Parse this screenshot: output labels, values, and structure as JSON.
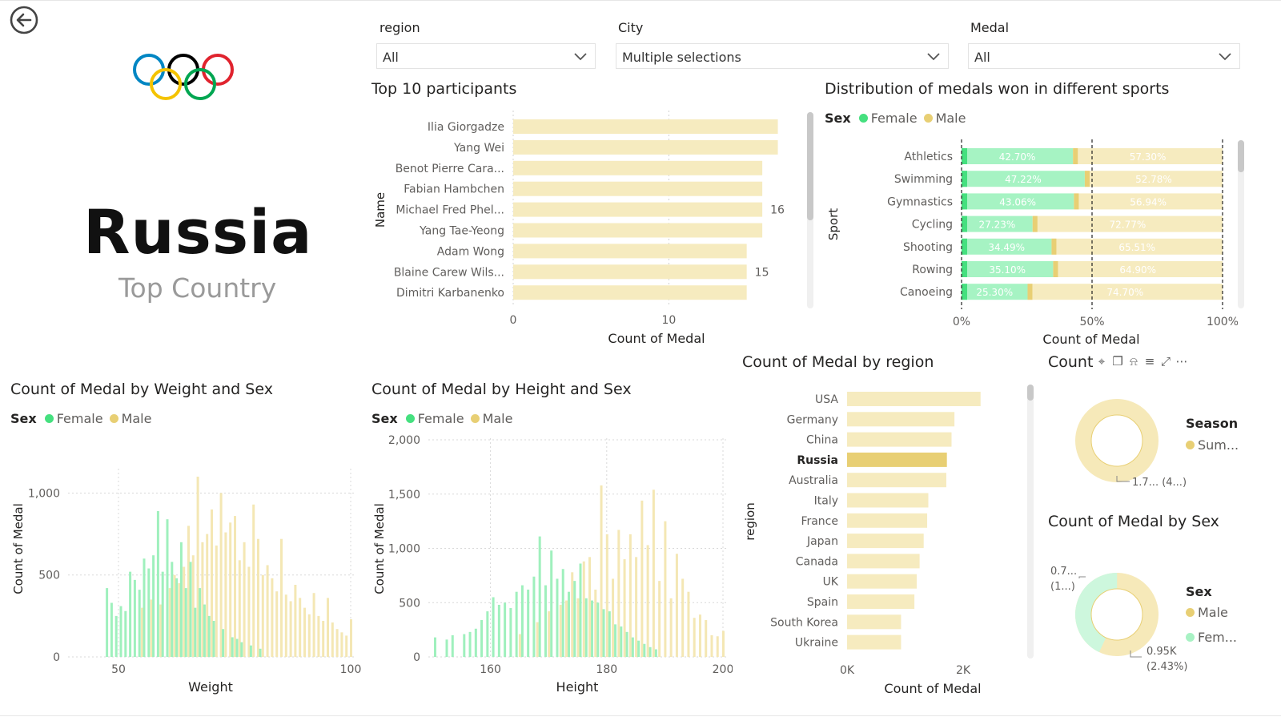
{
  "filters": [
    {
      "label": "region",
      "value": "All"
    },
    {
      "label": "City",
      "value": "Multiple selections"
    },
    {
      "label": "Medal",
      "value": "All"
    }
  ],
  "hero": {
    "country": "Russia",
    "subtitle": "Top Country"
  },
  "top_participants": {
    "title": "Top 10 participants",
    "xlabel": "Count of Medal",
    "ylabel": "Name",
    "ticks": [
      "0",
      "10"
    ]
  },
  "sports_dist": {
    "title": "Distribution of medals won in different sports",
    "legend_title": "Sex",
    "legend": [
      "Female",
      "Male"
    ],
    "ylabel": "Sport",
    "xlabel": "Count of Medal",
    "ticks": [
      "0%",
      "50%",
      "100%"
    ]
  },
  "weight_chart": {
    "title": "Count of Medal by Weight and Sex",
    "legend_title": "Sex",
    "legend": [
      "Female",
      "Male"
    ],
    "xlabel": "Weight",
    "ylabel": "Count of Medal",
    "xticks": [
      "50",
      "100"
    ],
    "yticks": [
      "0",
      "500",
      "1,000"
    ]
  },
  "height_chart": {
    "title": "Count of Medal by Height and Sex",
    "legend_title": "Sex",
    "legend": [
      "Female",
      "Male"
    ],
    "xlabel": "Height",
    "ylabel": "Count of Medal",
    "xticks": [
      "160",
      "180",
      "200"
    ],
    "yticks": [
      "0",
      "500",
      "1,000",
      "1,500",
      "2,000"
    ]
  },
  "region_chart": {
    "title": "Count of Medal by region",
    "xlabel": "Count of Medal",
    "ylabel": "region",
    "ticks": [
      "0K",
      "2K"
    ]
  },
  "season_donut": {
    "title": "Count",
    "legend_title": "Season",
    "legend": [
      "Sum..."
    ],
    "label": "1.7... (4...)"
  },
  "sex_donut": {
    "title": "Count of Medal by Sex",
    "legend_title": "Sex",
    "legend": [
      "Male",
      "Fem..."
    ],
    "label_female_1": "0.7...",
    "label_female_2": "(1...)",
    "label_male_1": "0.95K",
    "label_male_2": "(2.43%)"
  },
  "colors": {
    "female": "#45e07f",
    "male": "#e8cf74",
    "bar": "#f6ebbf",
    "highlight": "#e8cf74"
  },
  "chart_data": [
    {
      "type": "bar",
      "title": "Top 10 participants",
      "categories": [
        "Ilia Giorgadze",
        "Yang Wei",
        "Benot Pierre Cara...",
        "Fabian Hambchen",
        "Michael Fred Phel...",
        "Yang Tae-Yeong",
        "Adam Wong",
        "Blaine Carew Wils...",
        "Dimitri Karbanenko"
      ],
      "values": [
        17,
        17,
        16,
        16,
        16,
        16,
        15,
        15,
        15
      ],
      "data_labels": {
        "Michael Fred Phel...": "16",
        "Blaine Carew Wils...": "15"
      },
      "xlabel": "Count of Medal",
      "ylabel": "Name",
      "xlim": [
        0,
        18
      ]
    },
    {
      "type": "bar",
      "stacked": "100%",
      "title": "Distribution of medals won in different sports",
      "categories": [
        "Athletics",
        "Swimming",
        "Gymnastics",
        "Cycling",
        "Shooting",
        "Rowing",
        "Canoeing"
      ],
      "series": [
        {
          "name": "Female",
          "values": [
            42.7,
            47.22,
            43.06,
            27.23,
            34.49,
            35.1,
            25.3
          ],
          "labels": [
            "42.70%",
            "47.22%",
            "43.06%",
            "27.23%",
            "34.49%",
            "35.10%",
            "25.30%"
          ]
        },
        {
          "name": "Male",
          "values": [
            57.3,
            52.78,
            56.94,
            72.77,
            65.51,
            64.9,
            74.7
          ],
          "labels": [
            "57.30%",
            "52.78%",
            "56.94%",
            "72.77%",
            "65.51%",
            "64.90%",
            "74.70%"
          ]
        }
      ],
      "xlabel": "Count of Medal",
      "ylabel": "Sport",
      "xlim": [
        0,
        100
      ]
    },
    {
      "type": "bar",
      "title": "Count of Medal by region",
      "categories": [
        "USA",
        "Germany",
        "China",
        "Russia",
        "Australia",
        "Italy",
        "France",
        "Japan",
        "Canada",
        "UK",
        "Spain",
        "South Korea",
        "Ukraine"
      ],
      "values": [
        2300,
        1850,
        1800,
        1720,
        1710,
        1400,
        1380,
        1320,
        1250,
        1200,
        1160,
        930,
        930
      ],
      "highlight": "Russia",
      "xlabel": "Count of Medal",
      "ylabel": "region",
      "xlim": [
        0,
        2400
      ]
    },
    {
      "type": "bar",
      "title": "Count of Medal by Weight and Sex",
      "x_range": [
        50,
        100
      ],
      "series": [
        {
          "name": "Female",
          "x": [
            47,
            48,
            49,
            50,
            51,
            52,
            53,
            54,
            55,
            56,
            57,
            58,
            59,
            60,
            61,
            62,
            63,
            64,
            65,
            66,
            67,
            68,
            69,
            70,
            72,
            74,
            75,
            76,
            78,
            80
          ],
          "values": [
            420,
            330,
            250,
            310,
            280,
            520,
            470,
            410,
            600,
            540,
            620,
            890,
            520,
            840,
            580,
            480,
            700,
            420,
            580,
            300,
            420,
            320,
            250,
            220,
            170,
            120,
            110,
            90,
            70,
            50
          ]
        },
        {
          "name": "Male",
          "x": [
            55,
            57,
            59,
            61,
            62,
            63,
            64,
            65,
            66,
            67,
            68,
            69,
            70,
            71,
            72,
            73,
            74,
            75,
            76,
            77,
            78,
            79,
            80,
            81,
            82,
            83,
            84,
            85,
            86,
            87,
            88,
            89,
            90,
            91,
            92,
            93,
            94,
            95,
            96,
            97,
            98,
            99,
            100
          ],
          "values": [
            300,
            350,
            320,
            420,
            500,
            450,
            550,
            800,
            620,
            1100,
            700,
            750,
            900,
            680,
            1000,
            760,
            820,
            860,
            590,
            700,
            550,
            930,
            720,
            500,
            560,
            480,
            400,
            720,
            380,
            340,
            440,
            360,
            300,
            260,
            390,
            250,
            220,
            360,
            210,
            170,
            150,
            130,
            230
          ]
        }
      ],
      "xlabel": "Weight",
      "ylabel": "Count of Medal",
      "ylim": [
        0,
        1100
      ]
    },
    {
      "type": "bar",
      "title": "Count of Medal by Height and Sex",
      "x_range": [
        150,
        200
      ],
      "series": [
        {
          "name": "Female",
          "x": [
            150,
            152,
            153,
            155,
            156,
            157,
            158,
            159,
            160,
            161,
            162,
            163,
            164,
            165,
            166,
            167,
            168,
            169,
            170,
            171,
            172,
            173,
            174,
            175,
            176,
            177,
            178,
            179,
            180,
            181,
            182,
            183,
            184,
            185,
            186,
            187,
            188
          ],
          "values": [
            180,
            160,
            200,
            210,
            230,
            260,
            340,
            420,
            550,
            480,
            500,
            450,
            600,
            660,
            620,
            740,
            1110,
            660,
            980,
            720,
            810,
            600,
            700,
            860,
            540,
            520,
            500,
            440,
            420,
            300,
            280,
            230,
            180,
            150,
            120,
            90,
            70
          ]
        },
        {
          "name": "Male",
          "x": [
            165,
            168,
            170,
            172,
            173,
            174,
            175,
            176,
            177,
            178,
            179,
            180,
            181,
            182,
            183,
            184,
            185,
            186,
            187,
            188,
            189,
            190,
            191,
            192,
            193,
            194,
            195,
            196,
            197,
            198,
            199,
            200
          ],
          "values": [
            210,
            320,
            420,
            480,
            520,
            780,
            540,
            880,
            920,
            620,
            1580,
            1130,
            720,
            1170,
            900,
            1130,
            920,
            1440,
            1030,
            1540,
            700,
            1250,
            540,
            950,
            720,
            600,
            360,
            390,
            340,
            200,
            190,
            240
          ]
        }
      ],
      "xlabel": "Height",
      "ylabel": "Count of Medal",
      "ylim": [
        0,
        2000
      ]
    },
    {
      "type": "pie",
      "title": "Count",
      "categories": [
        "Sum..."
      ],
      "values": [
        100
      ],
      "labels": [
        "1.7... (4...)"
      ]
    },
    {
      "type": "pie",
      "title": "Count of Medal by Sex",
      "categories": [
        "Male",
        "Fem..."
      ],
      "values": [
        57,
        43
      ],
      "labels": [
        "0.95K (2.43%)",
        "0.7... (1...)"
      ]
    }
  ]
}
